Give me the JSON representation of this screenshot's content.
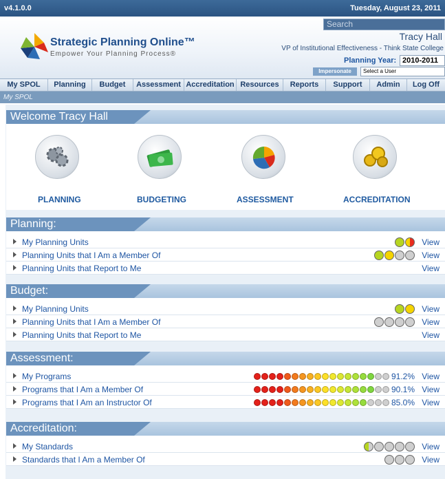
{
  "version": "v4.1.0.0",
  "date": "Tuesday, August 23, 2011",
  "search": {
    "placeholder": "Search"
  },
  "logo": {
    "title": "Strategic Planning Online™",
    "tagline": "Empower Your Planning Process®"
  },
  "user": {
    "name": "Tracy Hall",
    "title": "VP of Institutional Effectiveness - Think State College"
  },
  "planning_year": {
    "label": "Planning Year:",
    "value": "2010-2011"
  },
  "impersonate": {
    "label": "Impersonate",
    "select_value": "Select a User"
  },
  "nav": [
    "My SPOL",
    "Planning",
    "Budget",
    "Assessment",
    "Accreditation",
    "Resources",
    "Reports",
    "Support",
    "Admin",
    "Log Off"
  ],
  "breadcrumb": "My SPOL",
  "welcome": {
    "title": "Welcome Tracy Hall",
    "icons": [
      {
        "label": "PLANNING",
        "icon": "gears-icon"
      },
      {
        "label": "BUDGETING",
        "icon": "money-icon"
      },
      {
        "label": "ASSESSMENT",
        "icon": "pie-chart-icon"
      },
      {
        "label": "ACCREDITATION",
        "icon": "medal-icon"
      }
    ]
  },
  "colors": {
    "green": "#b7d521",
    "yellow": "#f5d400",
    "red": "#e82c1e",
    "gray": "#cfcfcf",
    "nav_text": "#1e3f6b",
    "link": "#1e55a3"
  },
  "sections": [
    {
      "title": "Planning:",
      "rows": [
        {
          "label": "My Planning Units",
          "view": "View",
          "dots": [
            "green",
            "half"
          ]
        },
        {
          "label": "Planning Units that I Am a Member Of",
          "view": "View",
          "dots": [
            "green",
            "yellow",
            "gray",
            "gray"
          ]
        },
        {
          "label": "Planning Units that Report to Me",
          "view": "View",
          "dots": []
        }
      ]
    },
    {
      "title": "Budget:",
      "rows": [
        {
          "label": "My Planning Units",
          "view": "View",
          "dots": [
            "green",
            "yellow"
          ]
        },
        {
          "label": "Planning Units that I Am a Member Of",
          "view": "View",
          "dots": [
            "gray",
            "gray",
            "gray",
            "gray"
          ]
        },
        {
          "label": "Planning Units that Report to Me",
          "view": "View",
          "dots": []
        }
      ]
    },
    {
      "title": "Assessment:",
      "rows": [
        {
          "label": "My Programs",
          "view": "View",
          "pct": "91.2%",
          "dots": [
            "#e4211a",
            "#e4211a",
            "#e4211a",
            "#e4211a",
            "#f05a1c",
            "#f37b1e",
            "#f59620",
            "#f8b022",
            "#fbc824",
            "#fde028",
            "#f1e82e",
            "#dce832",
            "#c6e636",
            "#aee23a",
            "#96dc3e",
            "#7fd640",
            "#cfcfcf",
            "#cfcfcf"
          ]
        },
        {
          "label": "Programs that I Am a Member Of",
          "view": "View",
          "pct": "90.1%",
          "dots": [
            "#e4211a",
            "#e4211a",
            "#e4211a",
            "#e4211a",
            "#f05a1c",
            "#f37b1e",
            "#f59620",
            "#f8b022",
            "#fbc824",
            "#fde028",
            "#f1e82e",
            "#dce832",
            "#c6e636",
            "#aee23a",
            "#96dc3e",
            "#7fd640",
            "#cfcfcf",
            "#cfcfcf"
          ]
        },
        {
          "label": "Programs that I Am an Instructor Of",
          "view": "View",
          "pct": "85.0%",
          "dots": [
            "#e4211a",
            "#e4211a",
            "#e4211a",
            "#e4211a",
            "#f05a1c",
            "#f37b1e",
            "#f59620",
            "#f8b022",
            "#fbc824",
            "#fde028",
            "#f1e82e",
            "#dce832",
            "#c6e636",
            "#aee23a",
            "#96dc3e",
            "#cfcfcf",
            "#cfcfcf",
            "#cfcfcf"
          ]
        }
      ]
    },
    {
      "title": "Accreditation:",
      "rows": [
        {
          "label": "My Standards",
          "view": "View",
          "dots": [
            "half-gray",
            "gray",
            "gray",
            "gray",
            "gray"
          ]
        },
        {
          "label": "Standards that I Am a Member Of",
          "view": "View",
          "dots": [
            "gray",
            "gray",
            "gray"
          ]
        }
      ]
    }
  ]
}
